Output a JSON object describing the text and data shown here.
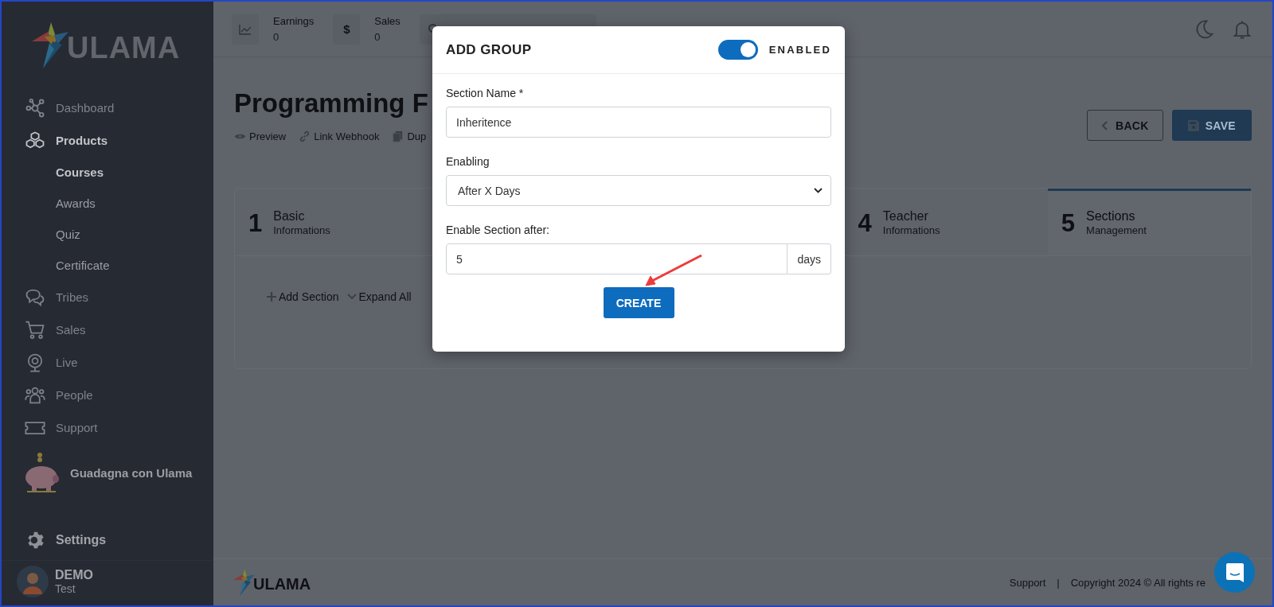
{
  "brand": {
    "logo_text": "ULAMA"
  },
  "sidebar": {
    "items": [
      {
        "label": "Dashboard",
        "disabled": true,
        "selected": false
      },
      {
        "label": "Products",
        "disabled": false,
        "selected": true,
        "children": [
          {
            "label": "Courses",
            "selected": true
          },
          {
            "label": "Awards",
            "selected": false
          },
          {
            "label": "Quiz",
            "selected": false
          },
          {
            "label": "Certificate",
            "selected": false
          }
        ]
      },
      {
        "label": "Tribes",
        "disabled": true,
        "selected": false
      },
      {
        "label": "Sales",
        "disabled": true,
        "selected": false
      },
      {
        "label": "Live",
        "disabled": true,
        "selected": false
      },
      {
        "label": "People",
        "disabled": true,
        "selected": false
      },
      {
        "label": "Support",
        "disabled": true,
        "selected": false
      }
    ],
    "promo": "Guadagna con Ulama",
    "settings": "Settings",
    "user": {
      "name": "DEMO",
      "role": "Test"
    }
  },
  "header": {
    "stats": [
      {
        "label": "Earnings",
        "value": "0"
      },
      {
        "label": "Sales",
        "value": "0",
        "icon_text": "$"
      }
    ]
  },
  "page": {
    "title": "Programming F",
    "actions": [
      "Preview",
      "Link Webhook",
      "Dup"
    ],
    "back_button": "BACK",
    "save_button": "SAVE"
  },
  "steps": [
    {
      "number": "1",
      "title": "Basic",
      "subtitle": "Informations",
      "selected": false
    },
    {
      "number": "4",
      "title": "Teacher",
      "subtitle": "Informations",
      "selected": false
    },
    {
      "number": "5",
      "title": "Sections",
      "subtitle": "Management",
      "selected": true
    }
  ],
  "section_tools": [
    "Add Section",
    "Expand All"
  ],
  "modal": {
    "title": "ADD GROUP",
    "toggle": {
      "on": true,
      "label": "ENABLED"
    },
    "fields": [
      {
        "kind": "text",
        "label": "Section Name *",
        "value": "Inheritence"
      },
      {
        "kind": "select",
        "label": "Enabling",
        "value": "After X Days"
      },
      {
        "kind": "addon",
        "label": "Enable Section after:",
        "value": "5",
        "addon": "days"
      }
    ],
    "create_button": "CREATE"
  },
  "footer": {
    "logo_text": "ULAMA",
    "links": [
      "Support"
    ],
    "separator": "|",
    "copyright": "Copyright 2024 © All rights re"
  }
}
